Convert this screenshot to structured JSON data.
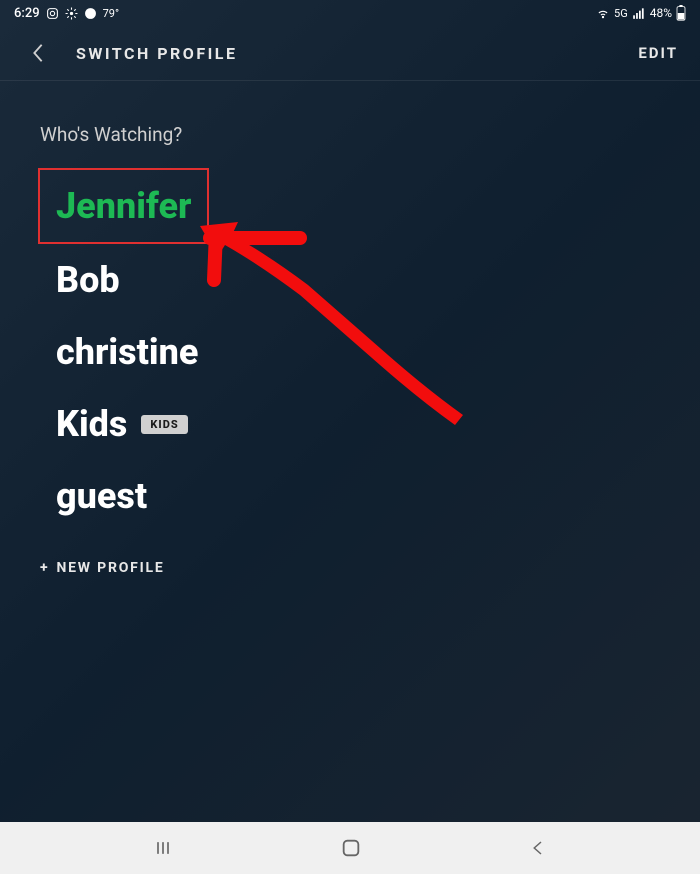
{
  "status_bar": {
    "time": "6:29",
    "temperature": "79°",
    "network_type": "5G",
    "battery": "48%"
  },
  "header": {
    "title": "SWITCH PROFILE",
    "edit_label": "EDIT"
  },
  "content": {
    "subtitle": "Who's Watching?",
    "profiles": [
      {
        "name": "Jennifer",
        "active": true,
        "kids": false
      },
      {
        "name": "Bob",
        "active": false,
        "kids": false
      },
      {
        "name": "christine",
        "active": false,
        "kids": false
      },
      {
        "name": "Kids",
        "active": false,
        "kids": true
      },
      {
        "name": "guest",
        "active": false,
        "kids": false
      }
    ],
    "kids_badge_label": "KIDS",
    "new_profile_label": "NEW PROFILE"
  },
  "annotation": {
    "highlight_color": "#e03030",
    "arrow_color": "#f20d0d"
  }
}
